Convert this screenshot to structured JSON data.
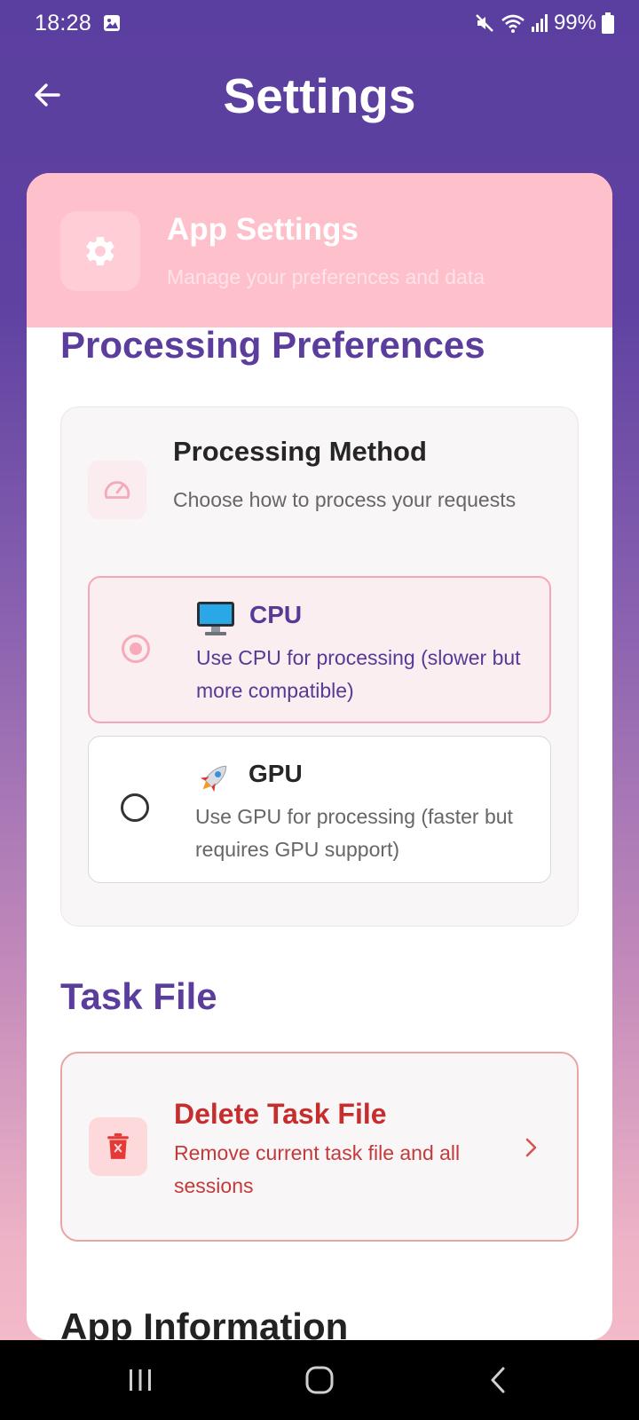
{
  "status_bar": {
    "time": "18:28",
    "battery": "99%",
    "icons": [
      "gallery-icon",
      "mute-icon",
      "wifi-icon",
      "signal-icon",
      "battery-icon"
    ]
  },
  "app_bar": {
    "title": "Settings",
    "back_icon": "arrow-left-icon"
  },
  "header": {
    "title": "App Settings",
    "subtitle": "Manage your preferences and data",
    "icon": "gear-icon"
  },
  "processing": {
    "section_title": "Processing Preferences",
    "method_title": "Processing Method",
    "method_desc": "Choose how to process your requests",
    "icon": "speedometer-icon",
    "options": [
      {
        "emoji": "🖥️",
        "name": "CPU",
        "desc": "Use CPU for processing (slower but more compatible)",
        "selected": true
      },
      {
        "emoji": "🚀",
        "name": "GPU",
        "desc": "Use GPU for processing (faster but requires GPU support)",
        "selected": false
      }
    ]
  },
  "task_file": {
    "section_title": "Task File",
    "delete_title": "Delete Task File",
    "delete_desc": "Remove current task file and all sessions",
    "icon": "trash-icon"
  },
  "next_section_partial": "App Information",
  "colors": {
    "primary": "#5b3d9e",
    "header_pink": "#fec0cb",
    "danger": "#c62e2e",
    "radio_selected": "#f7aab9"
  },
  "nav_bar": {
    "icons": [
      "recents-icon",
      "home-icon",
      "back-icon"
    ]
  }
}
